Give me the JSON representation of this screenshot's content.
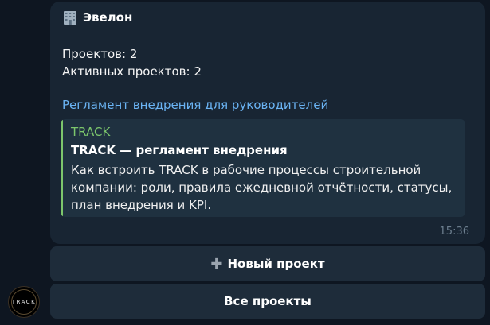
{
  "message": {
    "title": "Эвелон",
    "title_icon": "building-icon",
    "projects_line": "Проектов: 2",
    "active_line": "Активных проектов: 2",
    "link_text": "Регламент внедрения для руководителей",
    "preview": {
      "site_name": "TRACK",
      "title": "TRACK — регламент внедрения",
      "description": "Как встроить TRACK в рабочие процессы строительной компании: роли, правила ежедневной отчётности, статусы, план внедрения и KPI."
    },
    "time": "15:36"
  },
  "avatar": {
    "text": "TRACK"
  },
  "keyboard": {
    "new_project_label": "Новый проект",
    "new_project_icon": "plus-icon",
    "all_projects_label": "Все проекты"
  },
  "colors": {
    "background": "#0e1621",
    "bubble": "#182533",
    "link": "#6ab3f3",
    "preview_accent": "#7cc66c",
    "button": "#1e2c3a"
  }
}
